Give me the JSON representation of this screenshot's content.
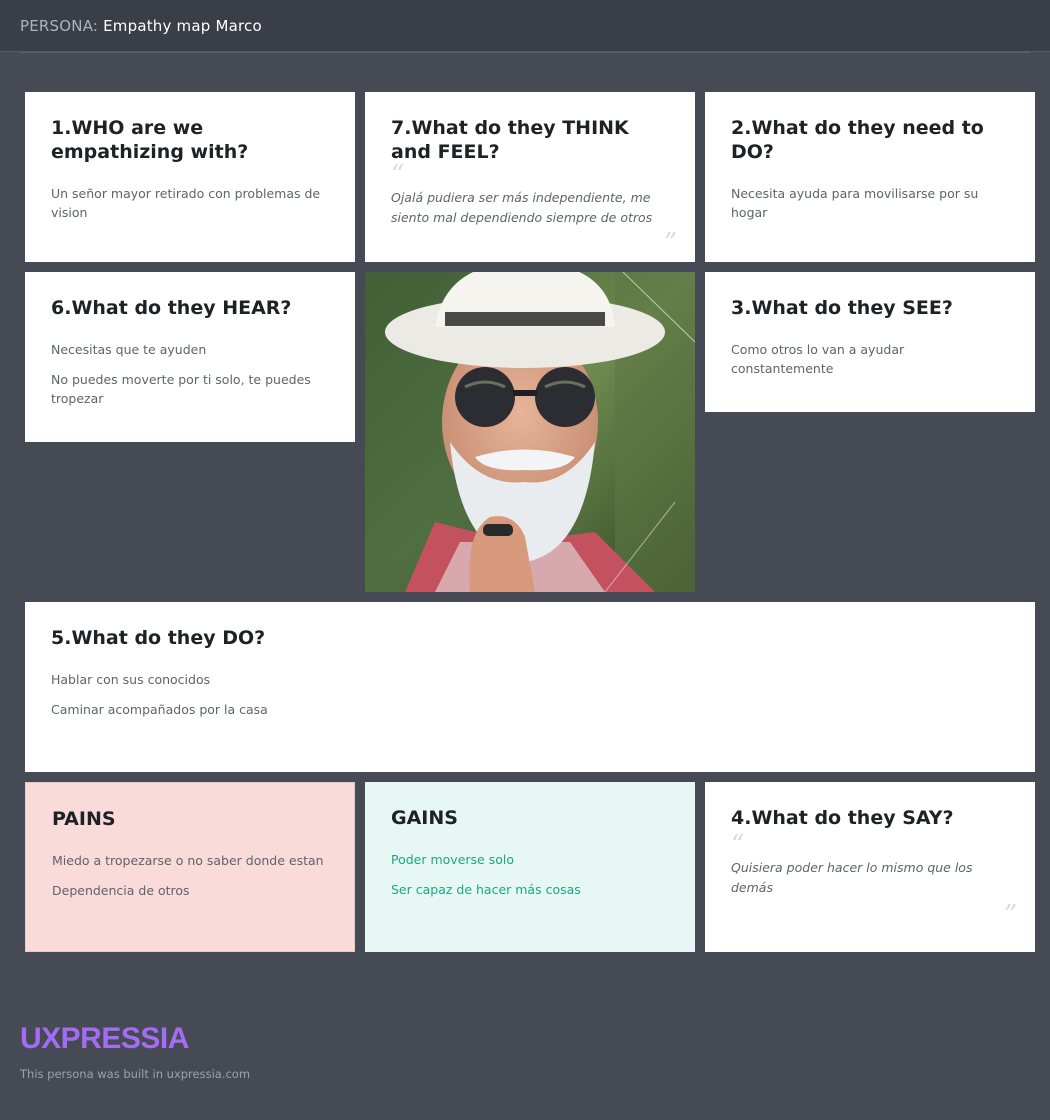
{
  "header": {
    "prefix": "PERSONA:",
    "title": "Empathy map Marco"
  },
  "cards": {
    "who": {
      "title": "1.WHO are we empathizing with?",
      "items": [
        "Un señor mayor retirado con problemas de vision"
      ]
    },
    "think_feel": {
      "title": "7.What do they THINK and FEEL?",
      "quote": "Ojalá pudiera ser más independiente, me siento mal dependiendo siempre de otros"
    },
    "need_do": {
      "title": "2.What do they need to DO?",
      "items": [
        "Necesita ayuda para movilisarse por su hogar"
      ]
    },
    "hear": {
      "title": "6.What do they HEAR?",
      "items": [
        "Necesitas que te ayuden",
        "No puedes moverte por ti solo, te puedes tropezar"
      ]
    },
    "see": {
      "title": "3.What do they SEE?",
      "items": [
        "Como otros lo van a ayudar constantemente"
      ]
    },
    "do": {
      "title": "5.What do they DO?",
      "items": [
        "Hablar con sus conocidos",
        "Caminar acompañados por la casa"
      ]
    },
    "pains": {
      "title": "PAINS",
      "items": [
        "Miedo a tropezarse o no saber donde estan",
        "Dependencia de otros"
      ]
    },
    "gains": {
      "title": "GAINS",
      "items": [
        "Poder moverse solo",
        "Ser capaz de hacer más cosas"
      ]
    },
    "say": {
      "title": "4.What do they SAY?",
      "quote": "Quisiera poder hacer lo mismo que los demás"
    }
  },
  "footer": {
    "logo": "UXPRESSIA",
    "note": "This persona was built in uxpressia.com"
  },
  "colors": {
    "background": "#464a54",
    "pains_bg": "#f9dcd9",
    "gains_bg": "#e6f7f4",
    "gains_text": "#1fa585",
    "logo": "#a46cf2"
  }
}
